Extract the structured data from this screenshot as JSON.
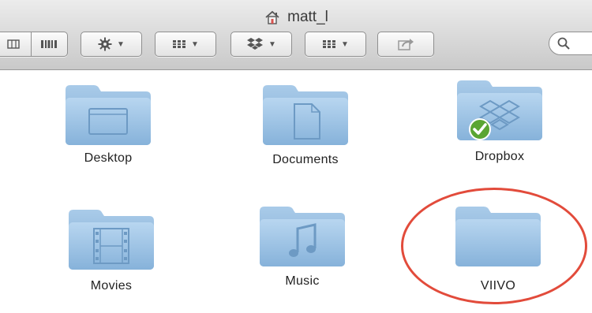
{
  "window": {
    "title": "matt_l",
    "title_icon": "home-icon"
  },
  "toolbar": {
    "view_buttons": [
      "columns-view-icon",
      "coverflow-view-icon"
    ],
    "action_button": {
      "icon": "gear-icon"
    },
    "arrange_button": {
      "icon": "grid-icon"
    },
    "dropbox_button": {
      "icon": "dropbox-icon"
    },
    "arrange_button_2": {
      "icon": "grid-icon"
    },
    "share_button": {
      "icon": "share-icon"
    },
    "search": {
      "icon": "search-icon"
    }
  },
  "folders": [
    {
      "label": "Desktop",
      "icon": "desktop-folder-icon"
    },
    {
      "label": "Documents",
      "icon": "documents-folder-icon"
    },
    {
      "label": "Dropbox",
      "icon": "dropbox-folder-icon",
      "badge": "synced-checkmark"
    },
    {
      "label": "Movies",
      "icon": "movies-folder-icon"
    },
    {
      "label": "Music",
      "icon": "music-folder-icon"
    },
    {
      "label": "VIIVO",
      "icon": "generic-folder-icon",
      "highlighted": true
    }
  ],
  "colors": {
    "highlight": "#e24b3b",
    "folder": "#9cc3e6"
  }
}
